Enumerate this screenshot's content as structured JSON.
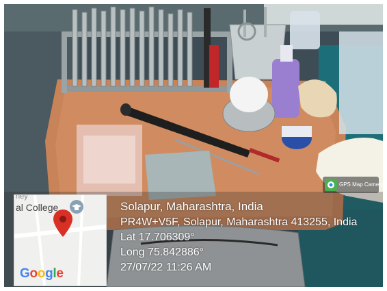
{
  "photo": {
    "description_icon": "photo-of-dental-instruments"
  },
  "map": {
    "place_label": "al College",
    "place_label_top": "hey",
    "brand": "Google",
    "brand_letters": [
      "G",
      "o",
      "o",
      "g",
      "l",
      "e"
    ],
    "brand_colors": [
      "#4285F4",
      "#EA4335",
      "#FBBC05",
      "#4285F4",
      "#34A853",
      "#EA4335"
    ],
    "pin_color": "#D93025"
  },
  "location": {
    "title": "Solapur, Maharashtra, India",
    "address": "PR4W+V5F, Solapur, Maharashtra 413255, India",
    "lat": "Lat 17.706309°",
    "long": "Long 75.842886°",
    "datetime": "27/07/22 11:26 AM"
  },
  "badge": {
    "label": "GPS Map Camera",
    "icon": "gps-map-camera-icon"
  }
}
